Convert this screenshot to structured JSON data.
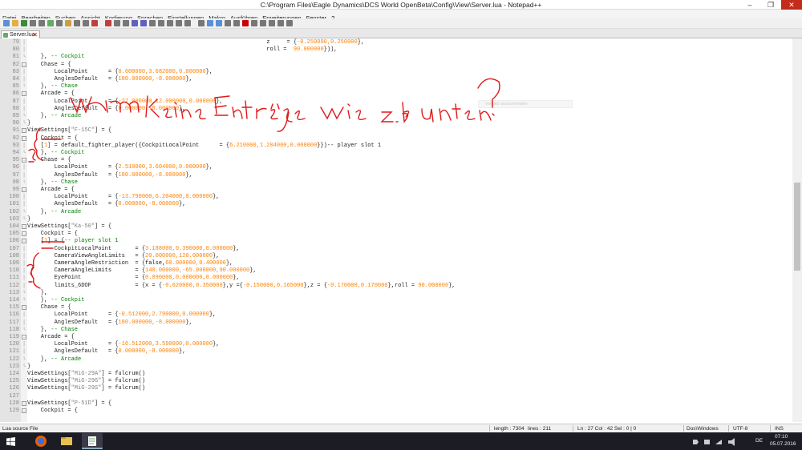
{
  "window": {
    "title": "C:\\Program Files\\Eagle Dynamics\\DCS World OpenBeta\\Config\\View\\Server.lua - Notepad++",
    "minimize": "–",
    "maximize": "❐",
    "close": "✕"
  },
  "menu": [
    "Datei",
    "Bearbeiten",
    "Suchen",
    "Ansicht",
    "Kodierung",
    "Sprachen",
    "Einstellungen",
    "Makro",
    "Ausführen",
    "Erweiterungen",
    "Fenster",
    "?"
  ],
  "tab": {
    "label": "Server.lua",
    "close": "✕"
  },
  "colors": {
    "keyword_blue": "#0000cc",
    "number_orange": "#ff7f00",
    "comment_green": "#008000",
    "string_gray": "#808080",
    "handwriting_red": "#e01818"
  },
  "lines": [
    {
      "n": "79",
      "fold": "line",
      "parts": [
        [
          "                                                                       ",
          "d"
        ],
        [
          "z     = {",
          "d"
        ],
        [
          "-0.250000,0.250000",
          "o"
        ],
        [
          "},",
          "d"
        ]
      ]
    },
    {
      "n": "80",
      "fold": "line",
      "parts": [
        [
          "                                                                       ",
          "d"
        ],
        [
          "roll =  ",
          "d"
        ],
        [
          "90.000000",
          "o"
        ],
        [
          "})),",
          "d"
        ]
      ]
    },
    {
      "n": "81",
      "fold": "end",
      "parts": [
        [
          "    }, ",
          "d"
        ],
        [
          "-- Cockpit",
          "c"
        ]
      ]
    },
    {
      "n": "82",
      "fold": "box",
      "parts": [
        [
          "    Chase = {",
          "d"
        ]
      ]
    },
    {
      "n": "83",
      "fold": "line",
      "parts": [
        [
          "        LocalPoint      = {",
          "d"
        ],
        [
          "0.600000,3.682000,0.000000",
          "o"
        ],
        [
          "},",
          "d"
        ]
      ]
    },
    {
      "n": "84",
      "fold": "line",
      "parts": [
        [
          "        AnglesDefault   = {",
          "d"
        ],
        [
          "180.000000,-8.000000",
          "o"
        ],
        [
          "},",
          "d"
        ]
      ]
    },
    {
      "n": "85",
      "fold": "end",
      "parts": [
        [
          "    }, ",
          "d"
        ],
        [
          "-- Chase",
          "c"
        ]
      ]
    },
    {
      "n": "86",
      "fold": "box",
      "parts": [
        [
          "    Arcade = {",
          "d"
        ]
      ]
    },
    {
      "n": "87",
      "fold": "line",
      "parts": [
        [
          "        LocalPoint      = {",
          "d"
        ],
        [
          "-27.000000,12.000000,0.000000",
          "o"
        ],
        [
          "},",
          "d"
        ]
      ]
    },
    {
      "n": "88",
      "fold": "line",
      "parts": [
        [
          "        AnglesDefault   = {",
          "d"
        ],
        [
          "0.000000,-8.000000",
          "o"
        ],
        [
          "},",
          "d"
        ]
      ]
    },
    {
      "n": "89",
      "fold": "end",
      "parts": [
        [
          "    }, ",
          "d"
        ],
        [
          "-- Arcade",
          "c"
        ]
      ]
    },
    {
      "n": "90",
      "fold": "end",
      "parts": [
        [
          "}",
          "d"
        ]
      ]
    },
    {
      "n": "91",
      "fold": "box",
      "parts": [
        [
          "ViewSettings[",
          "d"
        ],
        [
          "\"F-15C\"",
          "s"
        ],
        [
          "] = {",
          "d"
        ]
      ]
    },
    {
      "n": "92",
      "fold": "box",
      "parts": [
        [
          "    Cockpit = {",
          "d"
        ]
      ]
    },
    {
      "n": "93",
      "fold": "line",
      "parts": [
        [
          "    [",
          "d"
        ],
        [
          "1",
          "o"
        ],
        [
          "] = default_fighter_player({CockpitLocalPoint      = {",
          "d"
        ],
        [
          "6.210000,1.204000,0.000000",
          "o"
        ],
        [
          "}})-- player slot 1",
          "d"
        ]
      ]
    },
    {
      "n": "94",
      "fold": "end",
      "parts": [
        [
          "    }, ",
          "d"
        ],
        [
          "-- Cockpit",
          "c"
        ]
      ]
    },
    {
      "n": "95",
      "fold": "box",
      "parts": [
        [
          "    Chase = {",
          "d"
        ]
      ]
    },
    {
      "n": "96",
      "fold": "line",
      "parts": [
        [
          "        LocalPoint      = {",
          "d"
        ],
        [
          "2.510000,3.604000,0.000000",
          "o"
        ],
        [
          "},",
          "d"
        ]
      ]
    },
    {
      "n": "97",
      "fold": "line",
      "parts": [
        [
          "        AnglesDefault   = {",
          "d"
        ],
        [
          "180.000000,-8.000000",
          "o"
        ],
        [
          "},",
          "d"
        ]
      ]
    },
    {
      "n": "98",
      "fold": "end",
      "parts": [
        [
          "    }, ",
          "d"
        ],
        [
          "-- Chase",
          "c"
        ]
      ]
    },
    {
      "n": "99",
      "fold": "box",
      "parts": [
        [
          "    Arcade = {",
          "d"
        ]
      ]
    },
    {
      "n": "100",
      "fold": "line",
      "parts": [
        [
          "        LocalPoint      = {",
          "d"
        ],
        [
          "-13.790000,6.204000,0.000000",
          "o"
        ],
        [
          "},",
          "d"
        ]
      ]
    },
    {
      "n": "101",
      "fold": "line",
      "parts": [
        [
          "        AnglesDefault   = {",
          "d"
        ],
        [
          "0.000000,-8.000000",
          "o"
        ],
        [
          "},",
          "d"
        ]
      ]
    },
    {
      "n": "102",
      "fold": "end",
      "parts": [
        [
          "    }, ",
          "d"
        ],
        [
          "-- Arcade",
          "c"
        ]
      ]
    },
    {
      "n": "103",
      "fold": "end",
      "parts": [
        [
          "}",
          "d"
        ]
      ]
    },
    {
      "n": "104",
      "fold": "box",
      "parts": [
        [
          "ViewSettings[",
          "d"
        ],
        [
          "\"Ka-50\"",
          "s"
        ],
        [
          "] = {",
          "d"
        ]
      ]
    },
    {
      "n": "105",
      "fold": "box",
      "parts": [
        [
          "    Cockpit = {",
          "d"
        ]
      ]
    },
    {
      "n": "106",
      "fold": "box",
      "parts": [
        [
          "    [",
          "d"
        ],
        [
          "1",
          "o"
        ],
        [
          "] = {",
          "d"
        ],
        [
          "-- player slot 1",
          "c"
        ]
      ]
    },
    {
      "n": "107",
      "fold": "line",
      "parts": [
        [
          "        CockpitLocalPoint       = {",
          "d"
        ],
        [
          "3.188000,0.390000,0.000000",
          "o"
        ],
        [
          "},",
          "d"
        ]
      ]
    },
    {
      "n": "108",
      "fold": "line",
      "parts": [
        [
          "        CameraViewAngleLimits   = {",
          "d"
        ],
        [
          "20.000000,120.000000",
          "o"
        ],
        [
          "},",
          "d"
        ]
      ]
    },
    {
      "n": "109",
      "fold": "line",
      "parts": [
        [
          "        CameraAngleRestriction  = {false,",
          "d"
        ],
        [
          "60.000000,0.400000",
          "o"
        ],
        [
          "},",
          "d"
        ]
      ]
    },
    {
      "n": "110",
      "fold": "line",
      "parts": [
        [
          "        CameraAngleLimits       = {",
          "d"
        ],
        [
          "140.000000,-65.000000,90.000000",
          "o"
        ],
        [
          "},",
          "d"
        ]
      ]
    },
    {
      "n": "111",
      "fold": "line",
      "parts": [
        [
          "        EyePoint                = {",
          "d"
        ],
        [
          "0.090000,0.000000,0.000000",
          "o"
        ],
        [
          "},",
          "d"
        ]
      ]
    },
    {
      "n": "112",
      "fold": "line",
      "parts": [
        [
          "        limits_6DOF             = {x = {",
          "d"
        ],
        [
          "-0.020000,0.350000",
          "o"
        ],
        [
          "},y ={",
          "d"
        ],
        [
          "-0.150000,0.165000",
          "o"
        ],
        [
          "},z = {",
          "d"
        ],
        [
          "-0.170000,0.170000",
          "o"
        ],
        [
          "},roll = ",
          "d"
        ],
        [
          "90.000000",
          "o"
        ],
        [
          "},",
          "d"
        ]
      ]
    },
    {
      "n": "113",
      "fold": "end",
      "parts": [
        [
          "    },",
          "d"
        ]
      ]
    },
    {
      "n": "114",
      "fold": "end",
      "parts": [
        [
          "    }, ",
          "d"
        ],
        [
          "-- Cockpit",
          "c"
        ]
      ]
    },
    {
      "n": "115",
      "fold": "box",
      "parts": [
        [
          "    Chase = {",
          "d"
        ]
      ]
    },
    {
      "n": "116",
      "fold": "line",
      "parts": [
        [
          "        LocalPoint      = {",
          "d"
        ],
        [
          "-0.512000,2.790000,0.000000",
          "o"
        ],
        [
          "},",
          "d"
        ]
      ]
    },
    {
      "n": "117",
      "fold": "line",
      "parts": [
        [
          "        AnglesDefault   = {",
          "d"
        ],
        [
          "180.000000,-8.000000",
          "o"
        ],
        [
          "},",
          "d"
        ]
      ]
    },
    {
      "n": "118",
      "fold": "end",
      "parts": [
        [
          "    }, ",
          "d"
        ],
        [
          "-- Chase",
          "c"
        ]
      ]
    },
    {
      "n": "119",
      "fold": "box",
      "parts": [
        [
          "    Arcade = {",
          "d"
        ]
      ]
    },
    {
      "n": "120",
      "fold": "line",
      "parts": [
        [
          "        LocalPoint      = {",
          "d"
        ],
        [
          "-16.512000,3.590000,0.000000",
          "o"
        ],
        [
          "},",
          "d"
        ]
      ]
    },
    {
      "n": "121",
      "fold": "line",
      "parts": [
        [
          "        AnglesDefault   = {",
          "d"
        ],
        [
          "0.000000,-8.000000",
          "o"
        ],
        [
          "},",
          "d"
        ]
      ]
    },
    {
      "n": "122",
      "fold": "end",
      "parts": [
        [
          "    }, ",
          "d"
        ],
        [
          "-- Arcade",
          "c"
        ]
      ]
    },
    {
      "n": "123",
      "fold": "end",
      "parts": [
        [
          "}",
          "d"
        ]
      ]
    },
    {
      "n": "124",
      "fold": "none",
      "parts": [
        [
          "ViewSettings[",
          "d"
        ],
        [
          "\"MiG-29A\"",
          "s"
        ],
        [
          "] = fulcrum()",
          "d"
        ]
      ]
    },
    {
      "n": "125",
      "fold": "none",
      "parts": [
        [
          "ViewSettings[",
          "d"
        ],
        [
          "\"MiG-29G\"",
          "s"
        ],
        [
          "] = fulcrum()",
          "d"
        ]
      ]
    },
    {
      "n": "126",
      "fold": "none",
      "parts": [
        [
          "ViewSettings[",
          "d"
        ],
        [
          "\"MiG-29S\"",
          "s"
        ],
        [
          "] = fulcrum()",
          "d"
        ]
      ]
    },
    {
      "n": "127",
      "fold": "none",
      "parts": []
    },
    {
      "n": "128",
      "fold": "box",
      "parts": [
        [
          "ViewSettings[",
          "d"
        ],
        [
          "\"P-51D\"",
          "s"
        ],
        [
          "] = {",
          "d"
        ]
      ]
    },
    {
      "n": "129",
      "fold": "box",
      "parts": [
        [
          "    Cockpit = {",
          "d"
        ]
      ]
    }
  ],
  "ghost_text": "Vollbild ausschneiden",
  "handwriting": {
    "main": "warum keine Einträge wie z.B unten ?",
    "mark1": "1.",
    "mark2": "2."
  },
  "status": {
    "filetype": "Lua source File",
    "length": "length : 7304",
    "lines": "lines : 211",
    "position": "Ln : 27    Col : 42    Sel : 0 | 0",
    "eol": "Dos\\Windows",
    "encoding": "UTF-8",
    "mode": "INS"
  },
  "taskbar": {
    "lang": "DE",
    "time": "07:10",
    "date": "05.07.2016"
  }
}
